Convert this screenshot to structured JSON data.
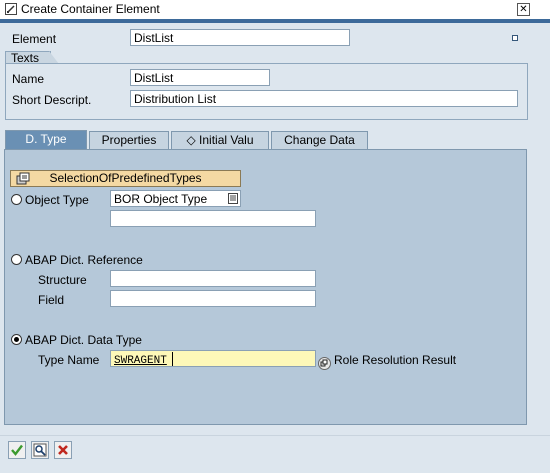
{
  "window": {
    "title": "Create Container Element",
    "close_glyph": "✕"
  },
  "header": {
    "element_label": "Element",
    "element_value": "DistList"
  },
  "texts": {
    "group_label": "Texts",
    "name_label": "Name",
    "name_value": "DistList",
    "short_desc_label": "Short Descript.",
    "short_desc_value": "Distribution List"
  },
  "tabs": [
    {
      "label": "D. Type",
      "active": true
    },
    {
      "label": "Properties",
      "active": false
    },
    {
      "label": "◇ Initial Valu",
      "active": false
    },
    {
      "label": "Change Data",
      "active": false
    }
  ],
  "dtype": {
    "predefined_button": "SelectionOfPredefinedTypes",
    "object_type_label": "Object Type",
    "object_type_value": "BOR Object Type",
    "object_type_extra_value": "",
    "abap_ref_label": "ABAP Dict. Reference",
    "structure_label": "Structure",
    "structure_value": "",
    "field_label": "Field",
    "field_value": "",
    "abap_type_label": "ABAP Dict. Data Type",
    "type_name_label": "Type Name",
    "type_name_value": "SWRAGENT",
    "role_result_label": "Role Resolution Result",
    "selected_radio": "abap_dict_data_type"
  },
  "toolbar": {
    "buttons": [
      "checkmark-icon",
      "search-icon",
      "cancel-icon"
    ]
  },
  "colors": {
    "active_tab": "#6a90b4",
    "panel": "#b5c8d9",
    "highlight_input": "#fdf8b8",
    "button_orange": "#f4d9a3"
  }
}
